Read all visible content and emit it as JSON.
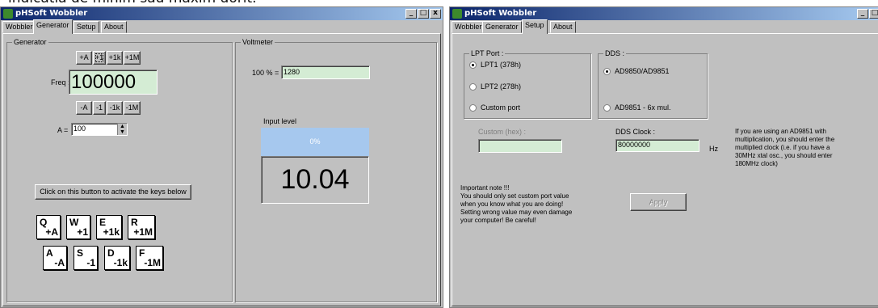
{
  "caption": "indicatia de minim sau maxim dorit.",
  "left_window": {
    "title": "pHSoft Wobbler",
    "tabs": [
      "Wobbler",
      "Generator",
      "Setup",
      "About"
    ],
    "generator": {
      "group_label": "Generator",
      "step_up_buttons": [
        "+A",
        "+1",
        "+1k",
        "+1M"
      ],
      "freq_label": "Freq :",
      "freq_value": "100000",
      "step_down_buttons": [
        "-A",
        "-1",
        "-1k",
        "-1M"
      ],
      "a_label": "A =",
      "a_value": "100",
      "activate_button": "Click on this button to activate the keys below",
      "keys_row1": [
        {
          "key": "Q",
          "value": "+A"
        },
        {
          "key": "W",
          "value": "+1"
        },
        {
          "key": "E",
          "value": "+1k"
        },
        {
          "key": "R",
          "value": "+1M"
        }
      ],
      "keys_row2": [
        {
          "key": "A",
          "value": "-A"
        },
        {
          "key": "S",
          "value": "-1"
        },
        {
          "key": "D",
          "value": "-1k"
        },
        {
          "key": "F",
          "value": "-1M"
        }
      ]
    },
    "voltmeter": {
      "group_label": "Voltmeter",
      "percent_label": "100 % =",
      "percent_value": "1280",
      "input_level_label": "Input level",
      "level_text": "0%",
      "level_fraction": 0,
      "reading": "10.04"
    },
    "level_bar_color": "#a6c8ee"
  },
  "right_window": {
    "title": "pHSoft Wobbler",
    "tabs": [
      "Wobbler",
      "Generator",
      "Setup",
      "About"
    ],
    "lpt": {
      "group_label": "LPT Port :",
      "options": [
        "LPT1 (378h)",
        "LPT2 (278h)",
        "Custom port"
      ],
      "selected": 0
    },
    "dds": {
      "group_label": "DDS :",
      "options": [
        "AD9850/AD9851",
        "AD9851 - 6x mul."
      ],
      "selected": 0
    },
    "custom_hex_label": "Custom (hex) :",
    "custom_hex_value": "",
    "dds_clock_label": "DDS Clock :",
    "dds_clock_value": "80000000",
    "dds_clock_unit": "Hz",
    "info_text": [
      "If you are using an AD9851 with",
      "multiplication, you should enter the",
      "multiplied clock (i.e. if you have a",
      "30MHz xtal osc., you should enter",
      "180MHz clock)"
    ],
    "important_note": [
      "Important note !!!",
      "You should only set custom port value",
      "when you know what you are doing!",
      "Setting wrong value may even damage",
      "your computer! Be careful!"
    ],
    "apply_button": "Apply"
  },
  "window_buttons": [
    "_",
    "□",
    "x"
  ]
}
